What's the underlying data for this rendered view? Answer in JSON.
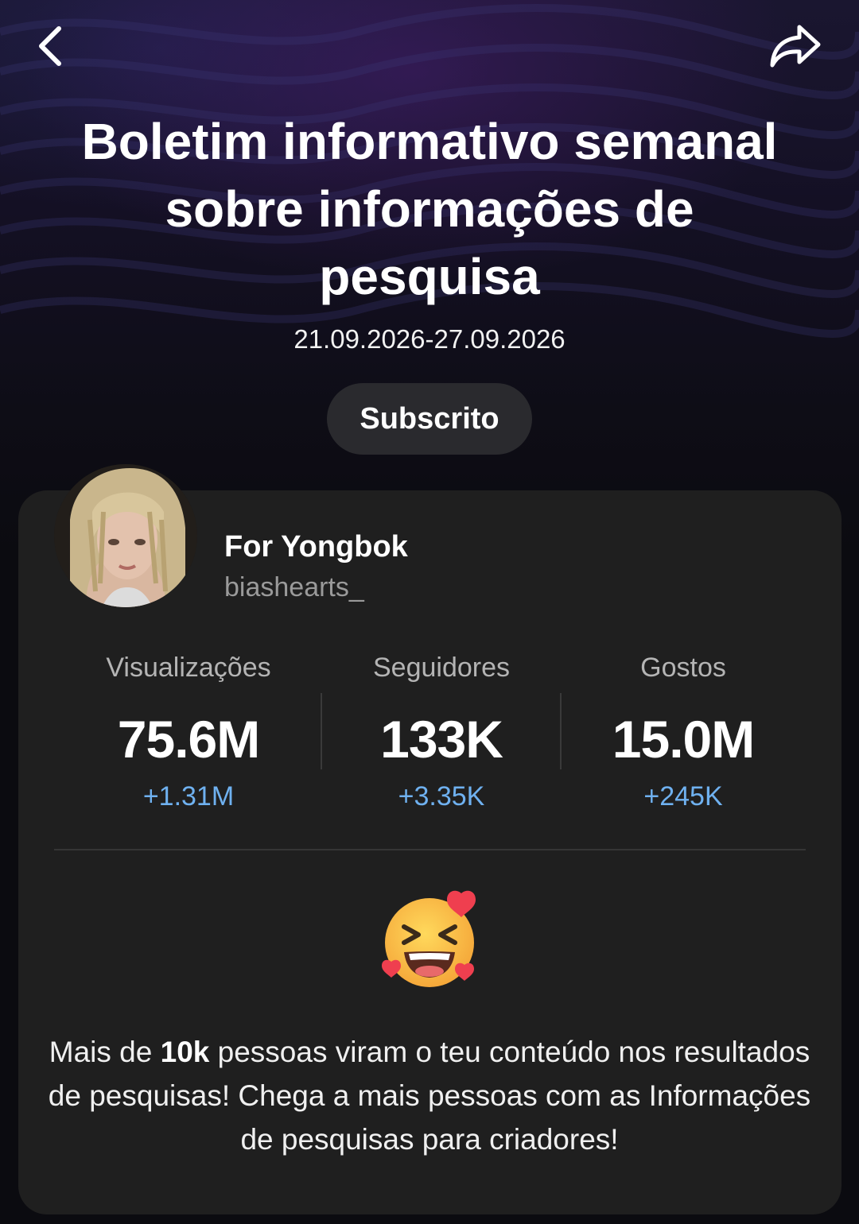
{
  "header": {
    "back_icon": "chevron-left-icon",
    "share_icon": "share-arrow-icon"
  },
  "report": {
    "title": "Boletim informativo semanal sobre informações de pesquisa",
    "date_range": "21.09.2026-27.09.2026",
    "subscribe_label": "Subscrito"
  },
  "profile": {
    "name": "For Yongbok",
    "handle": "biashearts_"
  },
  "stats": [
    {
      "label": "Visualizações",
      "value": "75.6M",
      "delta": "+1.31M"
    },
    {
      "label": "Seguidores",
      "value": "133K",
      "delta": "+3.35K"
    },
    {
      "label": "Gostos",
      "value": "15.0M",
      "delta": "+245K"
    }
  ],
  "message": {
    "emoji": "laughing-face-with-hearts-emoji",
    "text_before": "Mais de ",
    "highlight": "10k",
    "text_after": " pessoas viram o teu conteúdo nos resultados de pesquisas! Chega a mais pessoas com as Informações de pesquisas para criadores!"
  },
  "colors": {
    "card_background": "#1f1f1f",
    "delta_blue": "#6fb1f0",
    "button_background": "#2a2a2e"
  }
}
